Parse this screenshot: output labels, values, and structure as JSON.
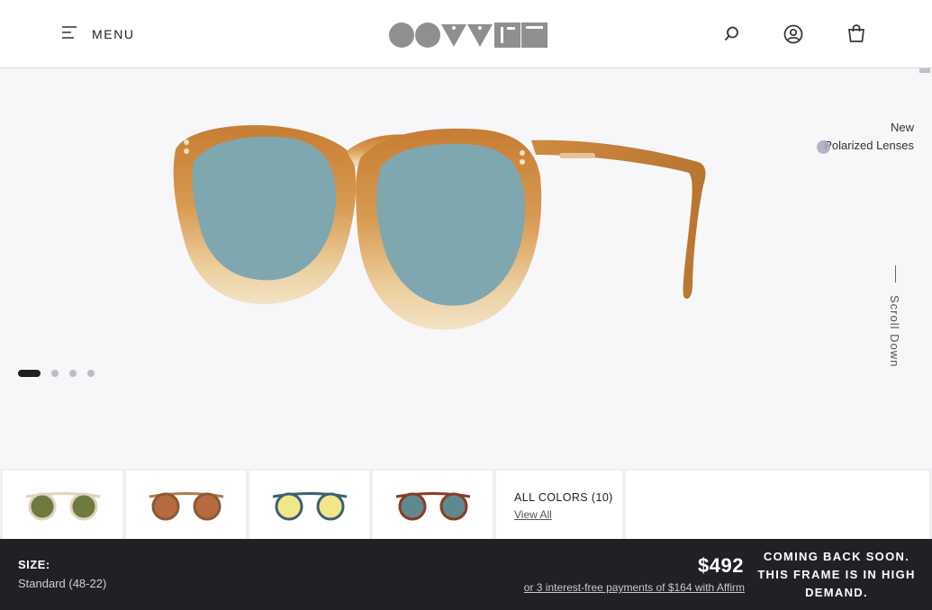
{
  "header": {
    "menu_label": "MENU",
    "logo_icon": "oliver-peoples-logo",
    "icons": [
      "search-icon",
      "account-icon",
      "bag-icon"
    ]
  },
  "hero": {
    "badge_line1": "New",
    "badge_line2": "Polarized Lenses",
    "scroll_label": "Scroll Down",
    "carousel": {
      "total": 4,
      "active_index": 0
    },
    "frame_color": "#c9893f",
    "lens_color": "#7fa7b0"
  },
  "colors": {
    "swatches": [
      {
        "name": "swatch-1",
        "frame": "#e0d3c0",
        "lens": "#6f7a3f"
      },
      {
        "name": "swatch-2",
        "frame": "#b07a4a",
        "lens": "#b86a3f"
      },
      {
        "name": "swatch-3",
        "frame": "#3e5f74",
        "lens": "#efe78a"
      },
      {
        "name": "swatch-4",
        "frame": "#8a3a24",
        "lens": "#5e8a8f"
      }
    ],
    "all_colors_label": "ALL COLORS (10)",
    "view_all_label": "View All"
  },
  "purchase": {
    "size_label": "SIZE:",
    "size_value": "Standard (48-22)",
    "price": "$492",
    "affirm_text": "or 3 interest-free payments of $164 with Affirm",
    "status_line1": "COMING BACK SOON.",
    "status_line2": "THIS FRAME IS IN HIGH",
    "status_line3": "DEMAND."
  }
}
